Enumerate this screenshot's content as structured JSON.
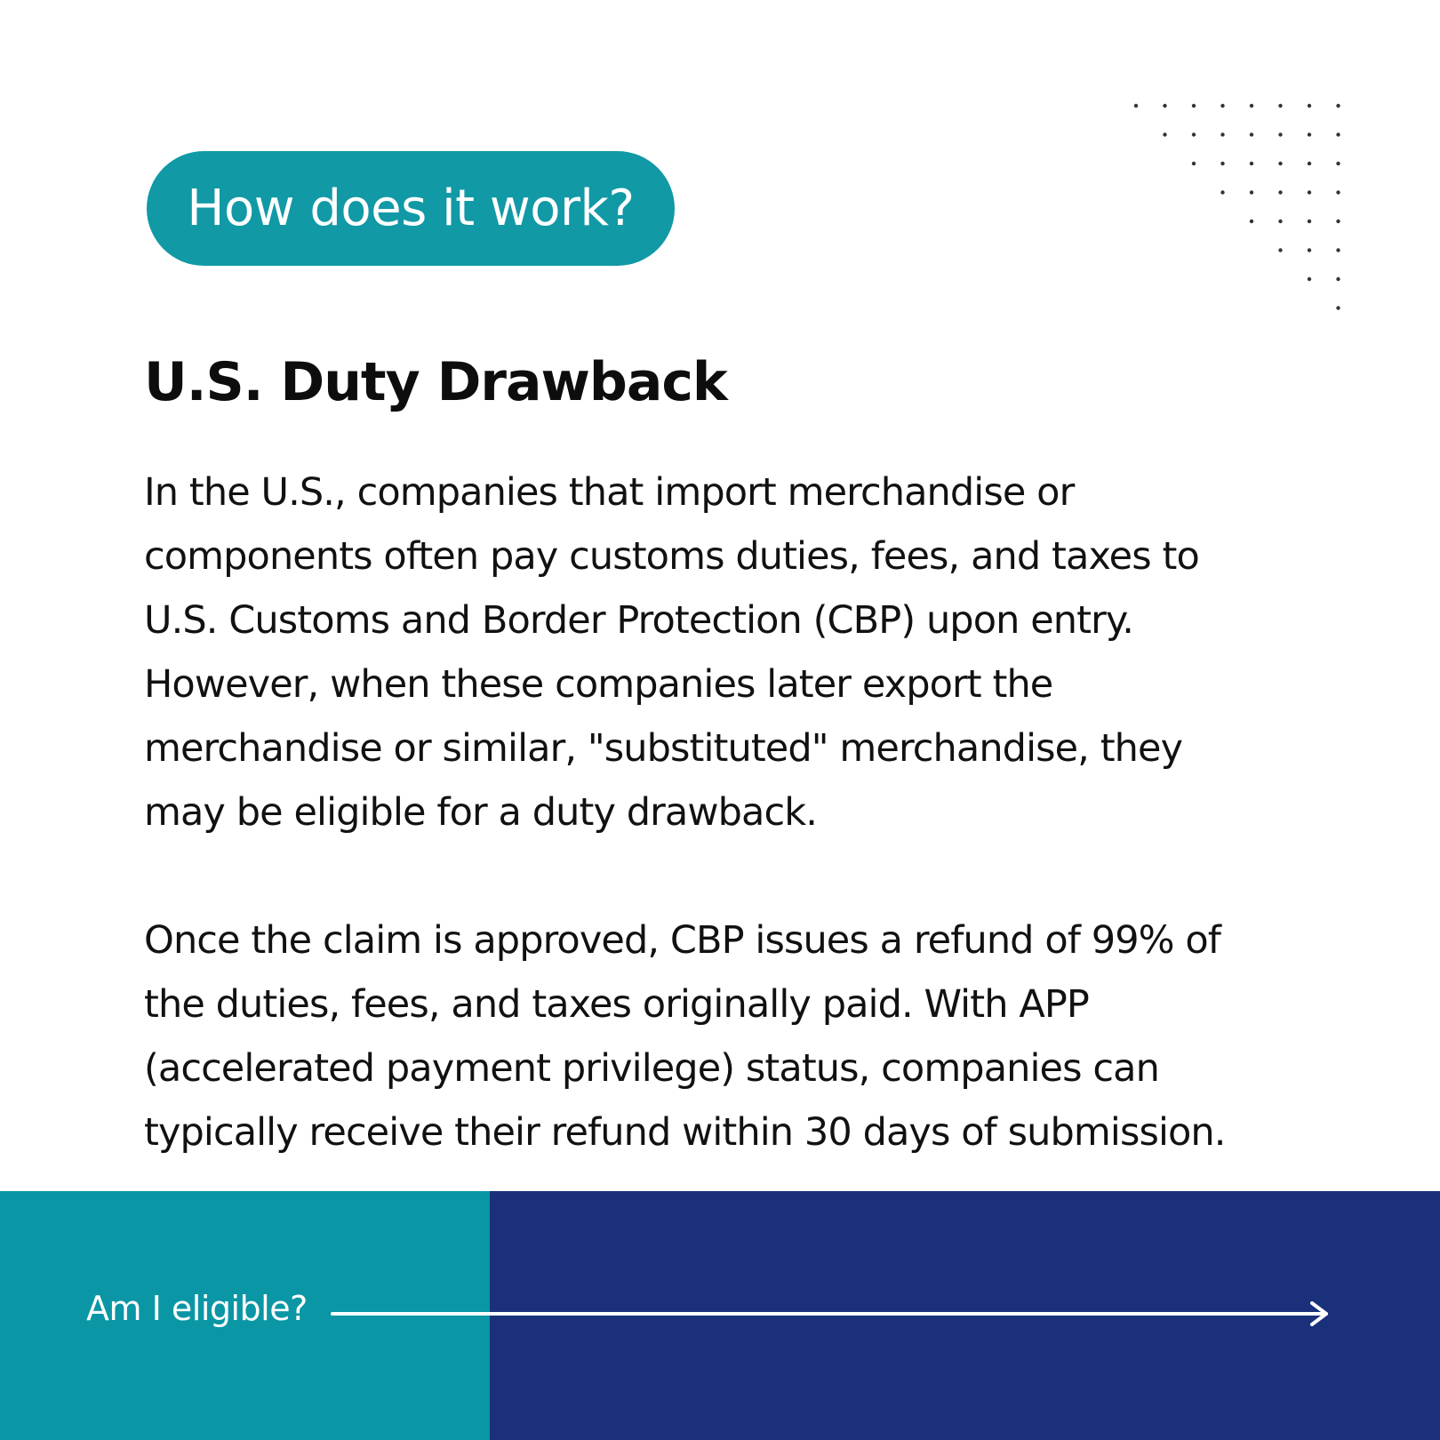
{
  "badge": {
    "label": "How does it work?"
  },
  "title": "U.S. Duty Drawback",
  "paragraphs": {
    "first": [
      "In the U.S., companies that import merchandise or",
      "components often pay customs duties, fees, and taxes to",
      "U.S. Customs and Border Protection (CBP) upon entry.",
      "However, when these companies later export the",
      "merchandise or similar, \"substituted\" merchandise, they",
      "may be eligible for a duty drawback."
    ],
    "second": [
      "Once the claim is approved, CBP issues a refund of 99% of",
      "the duties, fees, and taxes originally paid. With APP",
      "(accelerated payment privilege) status, companies can",
      "typically receive their refund within 30 days of  submission."
    ]
  },
  "footer": {
    "cta_label": "Am I eligible?",
    "cta_icon": "arrow-right-icon"
  },
  "colors": {
    "badge": "#1199a6",
    "footer_left": "#0a96a5",
    "footer_right": "#1a307b",
    "text": "#111111",
    "on_dark": "#ffffff",
    "dots": "#333333"
  }
}
